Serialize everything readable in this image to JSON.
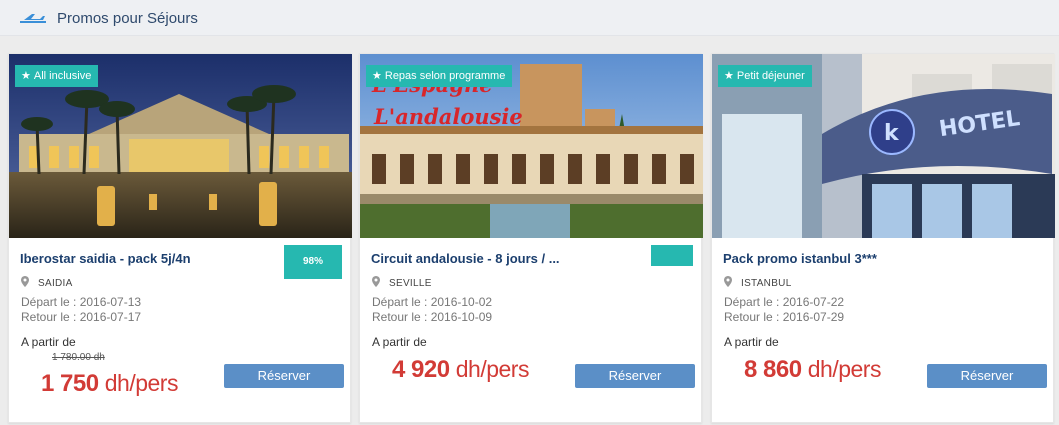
{
  "header": {
    "title": "Promos pour Séjours",
    "icon": "plane-icon"
  },
  "colors": {
    "badge": "#26b8b0",
    "price": "#d23b36",
    "button": "#5b8fc7",
    "name": "#1c3f6e"
  },
  "cards": [
    {
      "badge": "All inclusive",
      "name": "Iberostar saidia - pack 5j/4n",
      "score": "98%",
      "location": "SAIDIA",
      "depart": "Départ le : 2016-07-13",
      "retour": "Retour le : 2016-07-17",
      "from_label": "A partir de",
      "old_price": "1 780.00 dh",
      "price_value": "1 750",
      "price_unit": "dh/pers",
      "button": "Réserver"
    },
    {
      "badge": "Repas selon programme",
      "name": "Circuit andalousie - 8 jours / ...",
      "score": "",
      "location": "SEVILLE",
      "depart": "Départ le : 2016-10-02",
      "retour": "Retour le : 2016-10-09",
      "from_label": "A partir de",
      "image_text_1": "L'Espagne",
      "image_text_2": "L'andalousie",
      "price_value": "4 920",
      "price_unit": "dh/pers",
      "button": "Réserver"
    },
    {
      "badge": "Petit déjeuner",
      "name": "Pack promo istanbul 3***",
      "location": "ISTANBUL",
      "depart": "Départ le : 2016-07-22",
      "retour": "Retour le : 2016-07-29",
      "from_label": "A partir de",
      "image_text": "HOTEL",
      "price_value": "8 860",
      "price_unit": "dh/pers",
      "button": "Réserver"
    }
  ]
}
